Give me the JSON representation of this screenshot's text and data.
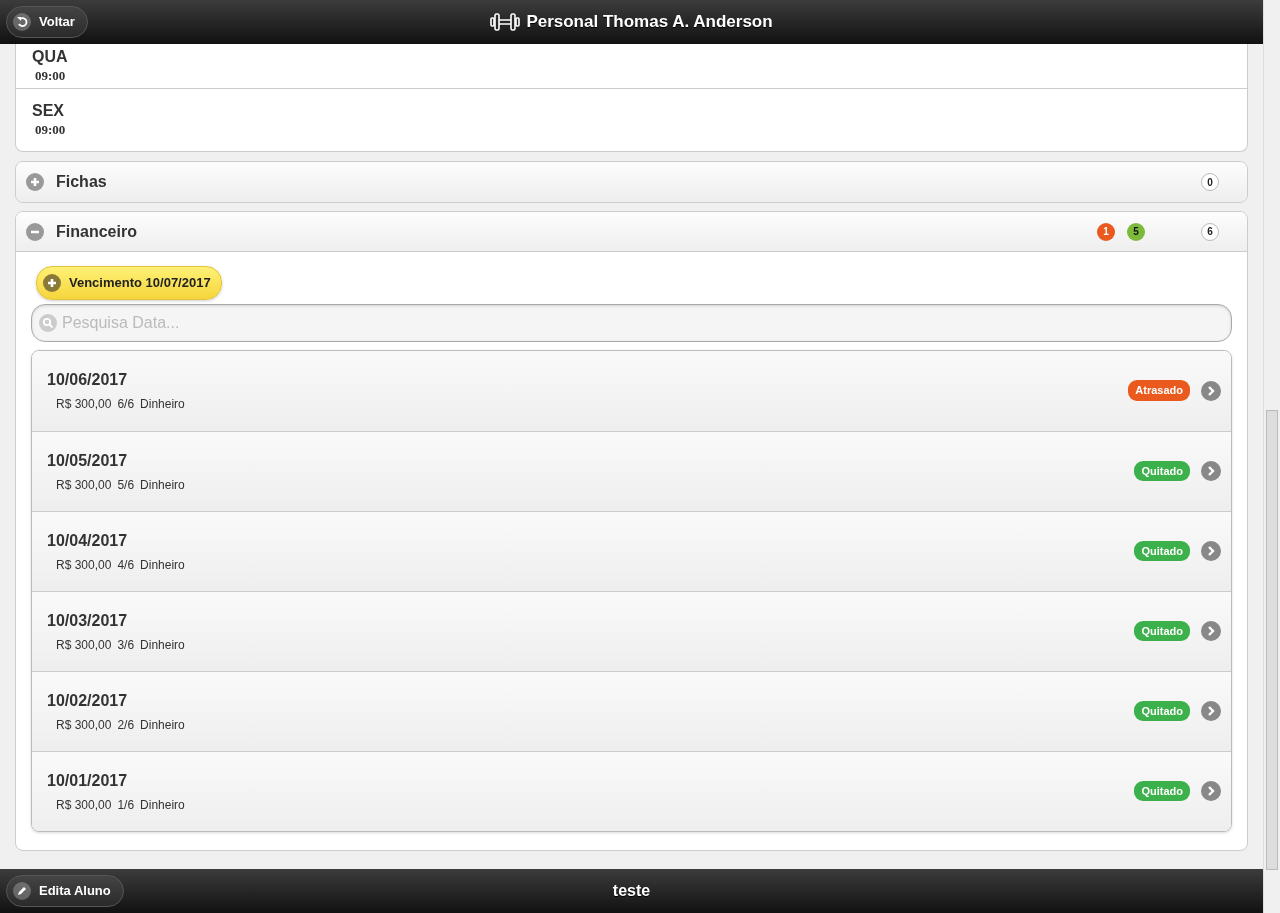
{
  "header": {
    "back_button": "Voltar",
    "title": "Personal Thomas A. Anderson"
  },
  "schedule": [
    {
      "day": "QUA",
      "time": "09:00"
    },
    {
      "day": "SEX",
      "time": "09:00"
    }
  ],
  "sections": [
    {
      "title": "Fichas",
      "expanded": false,
      "counts": [
        {
          "text": "0",
          "kind": "total"
        }
      ]
    },
    {
      "title": "Financeiro",
      "expanded": true,
      "counts": [
        {
          "text": "1",
          "kind": "late"
        },
        {
          "text": "5",
          "kind": "paid"
        },
        {
          "text": "6",
          "kind": "total"
        }
      ],
      "due_button": "Vencimento 10/07/2017",
      "search": {
        "placeholder": "Pesquisa Data..."
      },
      "payments": [
        {
          "date": "10/06/2017",
          "amount": "R$ 300,00",
          "installment": "6/6",
          "method": "Dinheiro",
          "status": "Atrasado",
          "kind": "late"
        },
        {
          "date": "10/05/2017",
          "amount": "R$ 300,00",
          "installment": "5/6",
          "method": "Dinheiro",
          "status": "Quitado",
          "kind": "paid"
        },
        {
          "date": "10/04/2017",
          "amount": "R$ 300,00",
          "installment": "4/6",
          "method": "Dinheiro",
          "status": "Quitado",
          "kind": "paid"
        },
        {
          "date": "10/03/2017",
          "amount": "R$ 300,00",
          "installment": "3/6",
          "method": "Dinheiro",
          "status": "Quitado",
          "kind": "paid"
        },
        {
          "date": "10/02/2017",
          "amount": "R$ 300,00",
          "installment": "2/6",
          "method": "Dinheiro",
          "status": "Quitado",
          "kind": "paid"
        },
        {
          "date": "10/01/2017",
          "amount": "R$ 300,00",
          "installment": "1/6",
          "method": "Dinheiro",
          "status": "Quitado",
          "kind": "paid"
        }
      ]
    }
  ],
  "footer": {
    "edit_button": "Edita Aluno",
    "title": "teste"
  }
}
